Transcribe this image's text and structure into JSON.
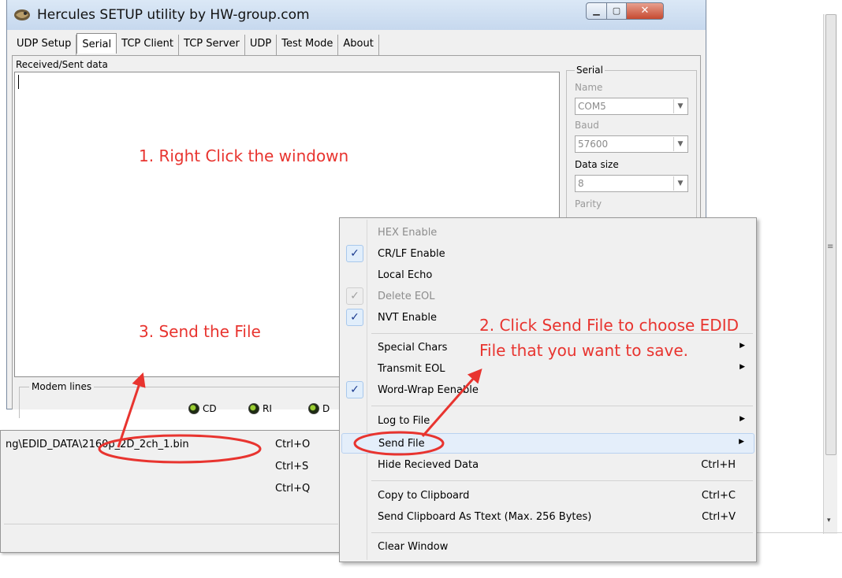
{
  "window": {
    "title": "Hercules SETUP utility by HW-group.com",
    "min_glyph": "▁",
    "max_glyph": "▢",
    "close_glyph": "✕"
  },
  "tabs": [
    {
      "label": "UDP Setup"
    },
    {
      "label": "Serial",
      "active": true
    },
    {
      "label": "TCP Client"
    },
    {
      "label": "TCP Server"
    },
    {
      "label": "UDP"
    },
    {
      "label": "Test Mode"
    },
    {
      "label": "About"
    }
  ],
  "received": {
    "label": "Received/Sent data"
  },
  "serial": {
    "group_title": "Serial",
    "name_label": "Name",
    "name_value": "COM5",
    "baud_label": "Baud",
    "baud_value": "57600",
    "datasize_label": "Data size",
    "datasize_value": "8",
    "parity_label": "Parity"
  },
  "modem": {
    "title": "Modem lines",
    "leds": [
      "CD",
      "RI",
      "D"
    ]
  },
  "submenu": {
    "rows": [
      {
        "path": "ng\\EDID_DATA\\2160p_2D_2ch_1.bin",
        "shortcut": "Ctrl+O"
      },
      {
        "path": "",
        "shortcut": "Ctrl+S"
      },
      {
        "path": "",
        "shortcut": "Ctrl+Q"
      }
    ]
  },
  "context_menu": {
    "items": [
      {
        "label": "HEX Enable",
        "disabled": true
      },
      {
        "label": "CR/LF Enable",
        "checked": true
      },
      {
        "label": "Local Echo"
      },
      {
        "label": "Delete EOL",
        "checked": true,
        "disabled": true
      },
      {
        "label": "NVT Enable",
        "checked": true
      },
      {
        "label": "Special Chars",
        "submenu": true
      },
      {
        "label": "Transmit EOL",
        "submenu": true
      },
      {
        "label": "Word-Wrap Eenable",
        "checked": true
      },
      {
        "label": "Log to File",
        "submenu": true
      },
      {
        "label": "Send File",
        "submenu": true,
        "highlighted": true
      },
      {
        "label": "Hide Recieved Data",
        "shortcut": "Ctrl+H"
      },
      {
        "label": "Copy to Clipboard",
        "shortcut": "Ctrl+C"
      },
      {
        "label": "Send Clipboard As Ttext (Max. 256 Bytes)",
        "shortcut": "Ctrl+V"
      },
      {
        "label": "Clear Window"
      }
    ],
    "check_glyph": "✓",
    "arrow_glyph": "▶"
  },
  "annotations": {
    "step1": "1. Right Click the windown",
    "step2_line1": "2. Click Send File to choose EDID",
    "step2_line2": "File that you want to save.",
    "step3": "3. Send the File",
    "color": "#e8342f"
  }
}
